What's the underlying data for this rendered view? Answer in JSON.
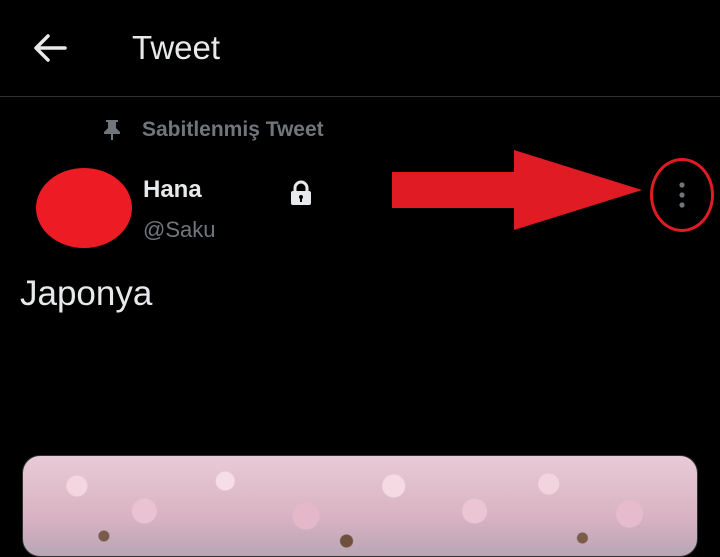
{
  "header": {
    "back_icon": "arrow-left-icon",
    "title": "Tweet"
  },
  "tweet": {
    "pinned_icon": "pin-icon",
    "pinned_label": "Sabitlenmiş Tweet",
    "author_name": "Hana",
    "author_handle": "@Saku",
    "protected_icon": "lock-icon",
    "more_icon": "more-vertical-icon",
    "text": "Japonya",
    "media": "cherry-blossom-image"
  },
  "annotation": {
    "arrow_color": "#e01b24",
    "circle_color": "#e01b24",
    "avatar_color": "#ed1c24"
  },
  "colors": {
    "background": "#000000",
    "primary_text": "#e7e9ea",
    "secondary_text": "#71767b",
    "divider": "#2f3336"
  }
}
